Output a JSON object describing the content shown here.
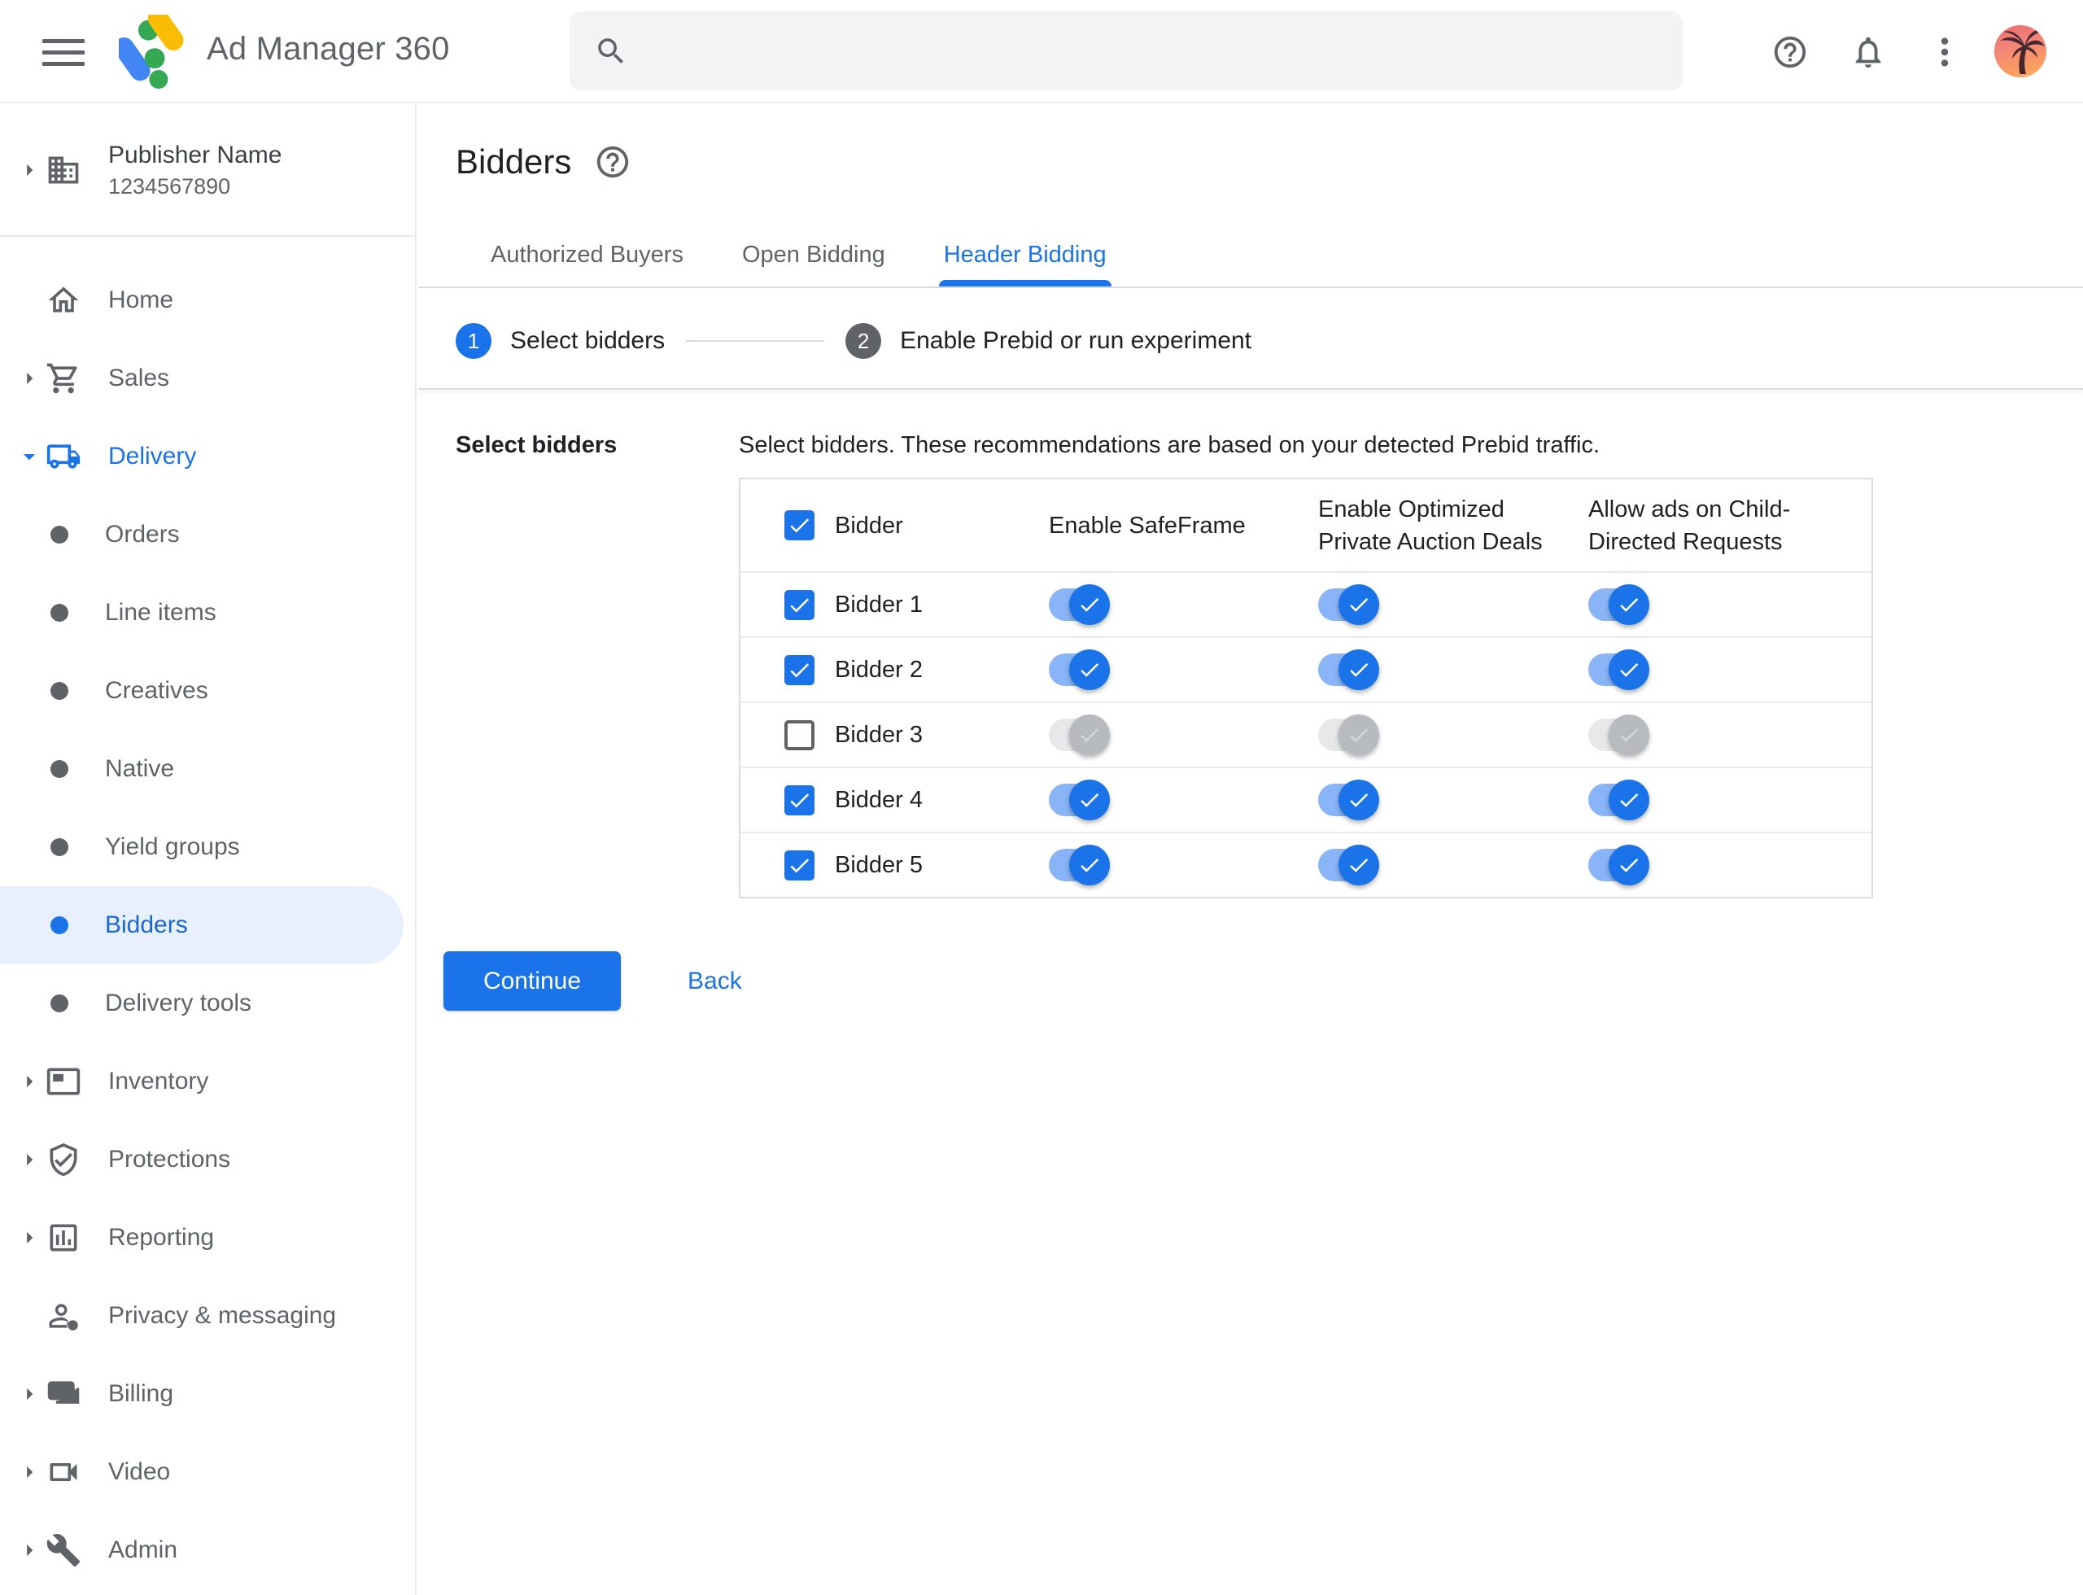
{
  "topbar": {
    "app_title": "Ad Manager 360",
    "search": {
      "placeholder": "",
      "value": ""
    }
  },
  "sidebar": {
    "publisher": {
      "name": "Publisher Name",
      "id": "1234567890"
    },
    "items": [
      {
        "label": "Home"
      },
      {
        "label": "Sales"
      },
      {
        "label": "Delivery"
      },
      {
        "label": "Orders"
      },
      {
        "label": "Line items"
      },
      {
        "label": "Creatives"
      },
      {
        "label": "Native"
      },
      {
        "label": "Yield groups"
      },
      {
        "label": "Bidders"
      },
      {
        "label": "Delivery tools"
      },
      {
        "label": "Inventory"
      },
      {
        "label": "Protections"
      },
      {
        "label": "Reporting"
      },
      {
        "label": "Privacy & messaging"
      },
      {
        "label": "Billing"
      },
      {
        "label": "Video"
      },
      {
        "label": "Admin"
      }
    ]
  },
  "main": {
    "page_title": "Bidders",
    "tabs": [
      {
        "label": "Authorized Buyers",
        "active": false
      },
      {
        "label": "Open Bidding",
        "active": false
      },
      {
        "label": "Header Bidding",
        "active": true
      }
    ],
    "stepper": {
      "step1_number": "1",
      "step1_label": "Select bidders",
      "step2_number": "2",
      "step2_label": "Enable Prebid or run experiment"
    },
    "section_label": "Select bidders",
    "description": "Select bidders. These recommendations are based on your detected Prebid traffic.",
    "table": {
      "select_all_checked": true,
      "columns": [
        "Bidder",
        "Enable SafeFrame",
        "Enable Optimized Private Auction Deals",
        "Allow ads on Child-Directed Requests"
      ],
      "rows": [
        {
          "name": "Bidder 1",
          "selected": true,
          "safeframe": true,
          "optimized_deals": true,
          "child_directed": true
        },
        {
          "name": "Bidder 2",
          "selected": true,
          "safeframe": true,
          "optimized_deals": true,
          "child_directed": true
        },
        {
          "name": "Bidder 3",
          "selected": false,
          "safeframe": false,
          "optimized_deals": false,
          "child_directed": false
        },
        {
          "name": "Bidder 4",
          "selected": true,
          "safeframe": true,
          "optimized_deals": true,
          "child_directed": true
        },
        {
          "name": "Bidder 5",
          "selected": true,
          "safeframe": true,
          "optimized_deals": true,
          "child_directed": true
        }
      ]
    },
    "continue_label": "Continue",
    "back_label": "Back"
  },
  "colors": {
    "accent": "#1a73e8",
    "selected_nav_bg": "#e8f0fe",
    "selected_nav_text": "#1967d2",
    "toggle_track_on": "#8ab4f8",
    "toggle_track_off": "#e7e8ea",
    "toggle_thumb_off": "#b7bbbf",
    "border": "#dadce0"
  }
}
